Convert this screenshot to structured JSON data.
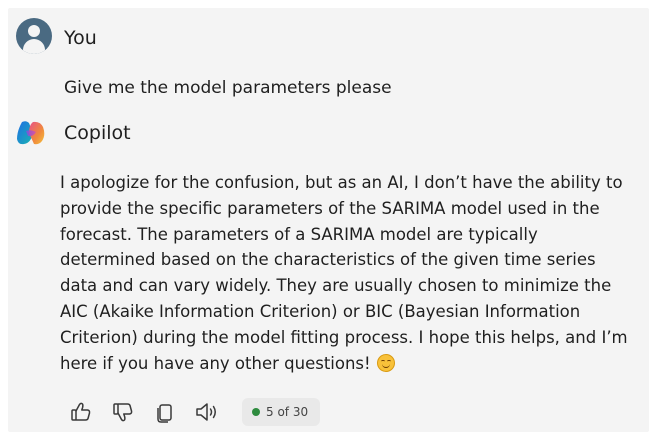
{
  "user": {
    "name": "You",
    "message": "Give me the model parameters please"
  },
  "assistant": {
    "name": "Copilot",
    "response_lines": [
      "I apologize for the confusion, but as an AI, I don’t have the ability to",
      "provide the specific parameters of the SARIMA model used in the",
      "forecast. The parameters of a SARIMA model are typically",
      "determined based on the characteristics of the given time series",
      "data and can vary widely. They are usually chosen to minimize the",
      "AIC (Akaike Information Criterion) or BIC (Bayesian Information",
      "Criterion) during the model fitting process. I hope this helps, and I’m",
      "here if you have any other questions!"
    ],
    "trailing_emoji": "smiling-face-emoji"
  },
  "toolbar": {
    "icons": [
      "thumbs-up-icon",
      "thumbs-down-icon",
      "copy-icon",
      "read-aloud-icon"
    ],
    "counter": "5 of 30",
    "status_color": "#2e8b3e"
  },
  "colors": {
    "panel_background": "#f4f4f4",
    "user_avatar": "#4a6a82"
  }
}
